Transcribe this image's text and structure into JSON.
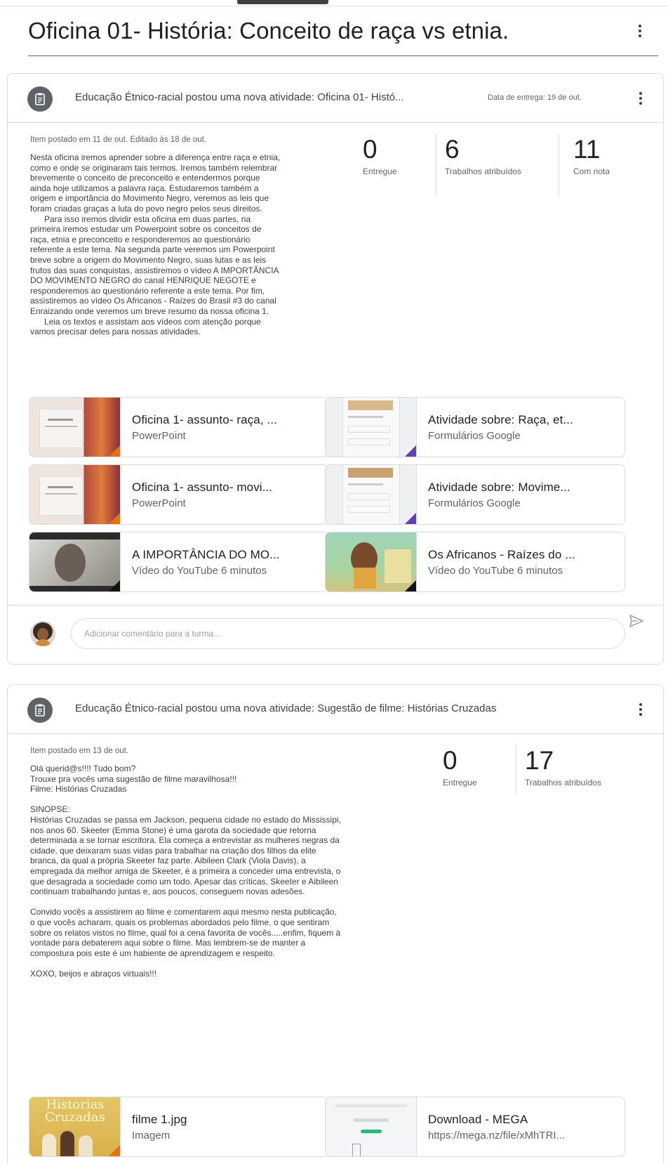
{
  "page": {
    "title": "Oficina 01- História: Conceito de raça vs etnia."
  },
  "posts": [
    {
      "header": "Educação Étnico-racial postou uma nova atividade: Oficina 01- Histó...",
      "due": "Data de entrega: 19 de out.",
      "posted": "Item postado em 11 de out. Editado às 18 de out.",
      "description": "Nesta oficina iremos aprender sobre a diferença entre raça e etnia,\ncomo e onde se originaram tais termos. Iremos também relembrar\nbrevemente o conceito de preconceito e entendermos porque\nainda hoje utilizamos a palavra raça. Estudaremos também a\norigem e importância do Movimento Negro, veremos as leis que\nforam criadas graças a luta do povo negro pelos seus direitos.\n      Para isso iremos dividir esta oficina em duas partes, na\nprimeira iremos estudar um Powerpoint sobre os conceitos de\nraça, etnia e preconceito e responderemos ao questionário\nreferente a este tema. Na segunda parte veremos um Powerpoint\nbreve sobre a origem do Movimento Negro, suas lutas e as leis\nfrutos das suas conquistas, assistiremos o vídeo A IMPORTÂNCIA\nDO MOVIMENTO NEGRO do canal HENRIQUE NEGOTE e\nresponderemos ao questionário referente a este tema. Por fim,\nassistiremos ao vídeo Os Africanos - Raízes do Brasil #3 do canal\nEnraizando onde veremos um breve resumo da nossa oficina 1.\n      Leia os textos e assistam aos vídeos com atenção porque\nvamos precisar deles para nossas atividades.",
      "stats": [
        {
          "value": "0",
          "label": "Entregue"
        },
        {
          "value": "6",
          "label": "Trabalhos atribuídos"
        },
        {
          "value": "11",
          "label": "Com nota"
        }
      ],
      "attachments": [
        {
          "title": "Oficina 1- assunto- raça, ...",
          "subtitle": "PowerPoint"
        },
        {
          "title": "Atividade sobre: Raça, et...",
          "subtitle": "Formulários Google"
        },
        {
          "title": "Oficina 1- assunto- movi...",
          "subtitle": "PowerPoint"
        },
        {
          "title": "Atividade sobre: Movime...",
          "subtitle": "Formulários Google"
        },
        {
          "title": "A IMPORTÂNCIA DO MO...",
          "subtitle": "Vídeo do YouTube   6 minutos"
        },
        {
          "title": "Os Africanos - Raízes do ...",
          "subtitle": "Vídeo do YouTube   6 minutos"
        }
      ],
      "comment_placeholder": "Adicionar comentário para a turma..."
    },
    {
      "header": "Educação Étnico-racial postou uma nova atividade: Sugestão de filme: Histórias Cruzadas",
      "posted": "Item postado em 13 de out.",
      "description": "Olá querid@s!!!! Tudo bom?\nTrouxe pra vocês uma sugestão de filme maravilhosa!!!\nFilme: Histórias Cruzadas\n\nSINOPSE:\nHistórias Cruzadas se passa em Jackson, pequena cidade no estado do Mississipi,\nnos anos 60. Skeeter (Emma Stone) é uma garota da sociedade que retorna\ndeterminada a se tornar escritora. Ela começa a entrevistar as mulheres negras da\ncidade, que deixaram suas vidas para trabalhar na criação dos filhos da elite\nbranca, da qual a própria Skeeter faz parte. Aibileen Clark (Viola Davis), a\nempregada da melhor amiga de Skeeter, é a primeira a conceder uma entrevista, o\nque desagrada a sociedade como um todo. Apesar das críticas, Skeeter e Aibileen\ncontinuam trabalhando juntas e, aos poucos, conseguem novas adesões.\n\nConvido vocês a assistirem ao filme e comentarem aqui mesmo nesta publicação,\no que vocês acharam, quais os problemas abordados pelo filme, o que sentiram\nsobre os relatos vistos no filme, qual foi a cena favorita de vocês.....enfim, fiquem à\nvontade para debaterem aqui sobre o filme. Mas lembrem-se de manter a\ncompostura pois este é um habiente de aprendizagem e respeito.\n\nXOXO, beijos e abraços virtuais!!!",
      "stats": [
        {
          "value": "0",
          "label": "Entregue"
        },
        {
          "value": "17",
          "label": "Trabalhos atribuídos"
        }
      ],
      "attachments": [
        {
          "title": "filme 1.jpg",
          "subtitle": "Imagem",
          "thumb_text": "Historias Cruzadas"
        },
        {
          "title": "Download - MEGA",
          "subtitle": "https://mega.nz/file/xMhTRI..."
        }
      ]
    }
  ]
}
